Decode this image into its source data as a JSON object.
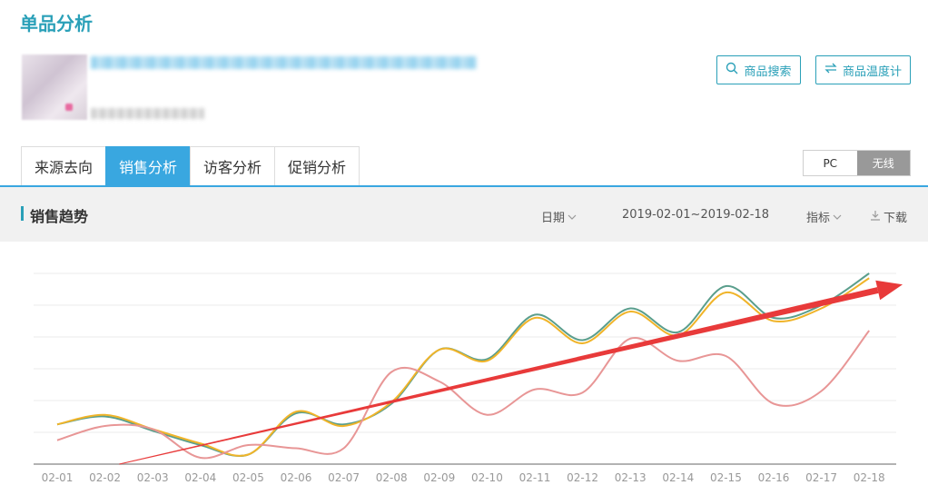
{
  "header": {
    "title": "单品分析"
  },
  "actions": {
    "search_label": "商品搜索",
    "temp_label": "商品温度计"
  },
  "tabs": [
    {
      "label": "来源去向",
      "active": false
    },
    {
      "label": "销售分析",
      "active": true
    },
    {
      "label": "访客分析",
      "active": false
    },
    {
      "label": "促销分析",
      "active": false
    }
  ],
  "device_toggle": {
    "pc": "PC",
    "wireless": "无线",
    "selected": "无线"
  },
  "section": {
    "title": "销售趋势",
    "date_label": "日期",
    "date_range": "2019-02-01~2019-02-18",
    "metric_label": "指标",
    "download_label": "下载"
  },
  "colors": {
    "accent": "#2aa0b8",
    "tab_active": "#39a7e0",
    "series_green": "#5a9e8c",
    "series_orange": "#f0b429",
    "series_pink": "#e89696",
    "arrow": "#e83a3a"
  },
  "chart_data": {
    "type": "line",
    "categories": [
      "02-01",
      "02-02",
      "02-03",
      "02-04",
      "02-05",
      "02-06",
      "02-07",
      "02-08",
      "02-09",
      "02-10",
      "02-11",
      "02-12",
      "02-13",
      "02-14",
      "02-15",
      "02-16",
      "02-17",
      "02-18"
    ],
    "ylim": [
      0,
      6
    ],
    "grid": true,
    "series": [
      {
        "values": [
          1.25,
          1.5,
          1.05,
          0.6,
          0.3,
          1.6,
          1.25,
          1.9,
          3.6,
          3.3,
          4.7,
          3.9,
          4.9,
          4.15,
          5.6,
          4.6,
          5.0,
          6.0
        ]
      },
      {
        "values": [
          1.25,
          1.55,
          1.1,
          0.65,
          0.3,
          1.65,
          1.2,
          1.95,
          3.6,
          3.25,
          4.6,
          3.8,
          4.8,
          4.05,
          5.4,
          4.5,
          4.9,
          5.85
        ]
      },
      {
        "values": [
          0.75,
          1.2,
          1.1,
          0.2,
          0.6,
          0.5,
          0.5,
          2.9,
          2.6,
          1.55,
          2.35,
          2.25,
          3.95,
          3.25,
          3.4,
          1.9,
          2.3,
          4.2
        ]
      }
    ],
    "annotations": [
      {
        "type": "arrow",
        "from": [
          1.3,
          0.0
        ],
        "to": [
          17.7,
          5.65
        ]
      }
    ]
  }
}
